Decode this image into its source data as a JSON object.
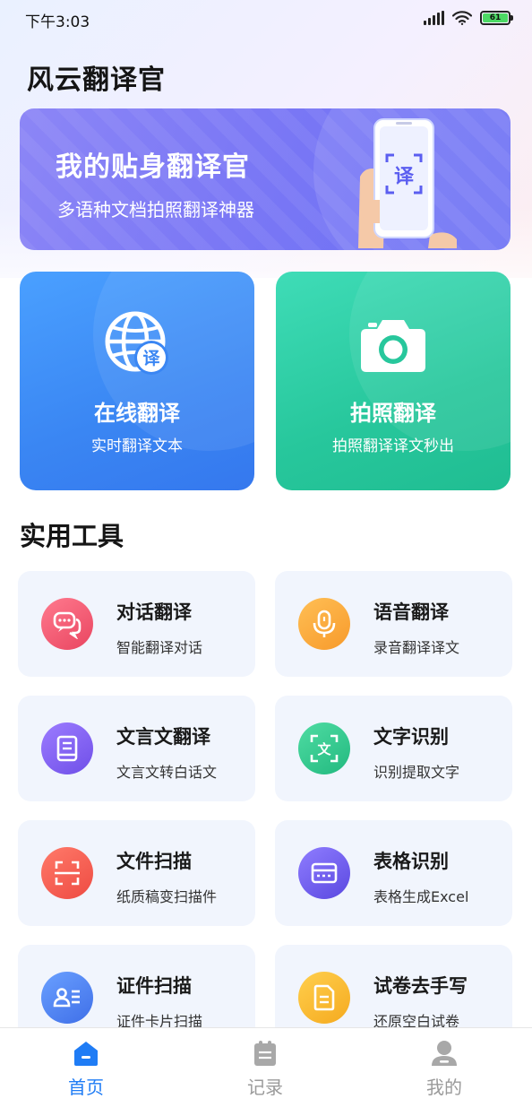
{
  "status_bar": {
    "time": "下午3:03",
    "battery": "61"
  },
  "app": {
    "title": "风云翻译官"
  },
  "banner": {
    "title": "我的贴身翻译官",
    "subtitle": "多语种文档拍照翻译神器",
    "phone_glyph": "译"
  },
  "features": [
    {
      "title": "在线翻译",
      "subtitle": "实时翻译文本",
      "badge": "译",
      "icon": "globe-translate-icon",
      "color": "#3a86f3"
    },
    {
      "title": "拍照翻译",
      "subtitle": "拍照翻译译文秒出",
      "icon": "camera-icon",
      "color": "#27c79c"
    }
  ],
  "tools_section": {
    "title": "实用工具"
  },
  "tools": [
    {
      "name": "对话翻译",
      "desc": "智能翻译对话",
      "icon": "chat-bubbles-icon",
      "color": "#f0506e"
    },
    {
      "name": "语音翻译",
      "desc": "录音翻译译文",
      "icon": "microphone-icon",
      "color": "#f7a135"
    },
    {
      "name": "文言文翻译",
      "desc": "文言文转白话文",
      "icon": "book-icon",
      "color": "#7b5cf0"
    },
    {
      "name": "文字识别",
      "desc": "识别提取文字",
      "icon": "scan-text-icon",
      "glyph": "文",
      "color": "#2cc38c"
    },
    {
      "name": "文件扫描",
      "desc": "纸质稿变扫描件",
      "icon": "scan-document-icon",
      "color": "#f25a4f"
    },
    {
      "name": "表格识别",
      "desc": "表格生成Excel",
      "icon": "table-icon",
      "color": "#6b5ae8"
    },
    {
      "name": "证件扫描",
      "desc": "证件卡片扫描",
      "icon": "id-card-icon",
      "color": "#4a7ef0"
    },
    {
      "name": "试卷去手写",
      "desc": "还原空白试卷",
      "icon": "paper-icon",
      "color": "#f7b52c"
    }
  ],
  "nav": {
    "items": [
      {
        "label": "首页",
        "icon": "home-icon",
        "active": true
      },
      {
        "label": "记录",
        "icon": "records-icon",
        "active": false
      },
      {
        "label": "我的",
        "icon": "profile-icon",
        "active": false
      }
    ],
    "active_color": "#1f7cf5",
    "inactive_color": "#9a9a9a"
  }
}
